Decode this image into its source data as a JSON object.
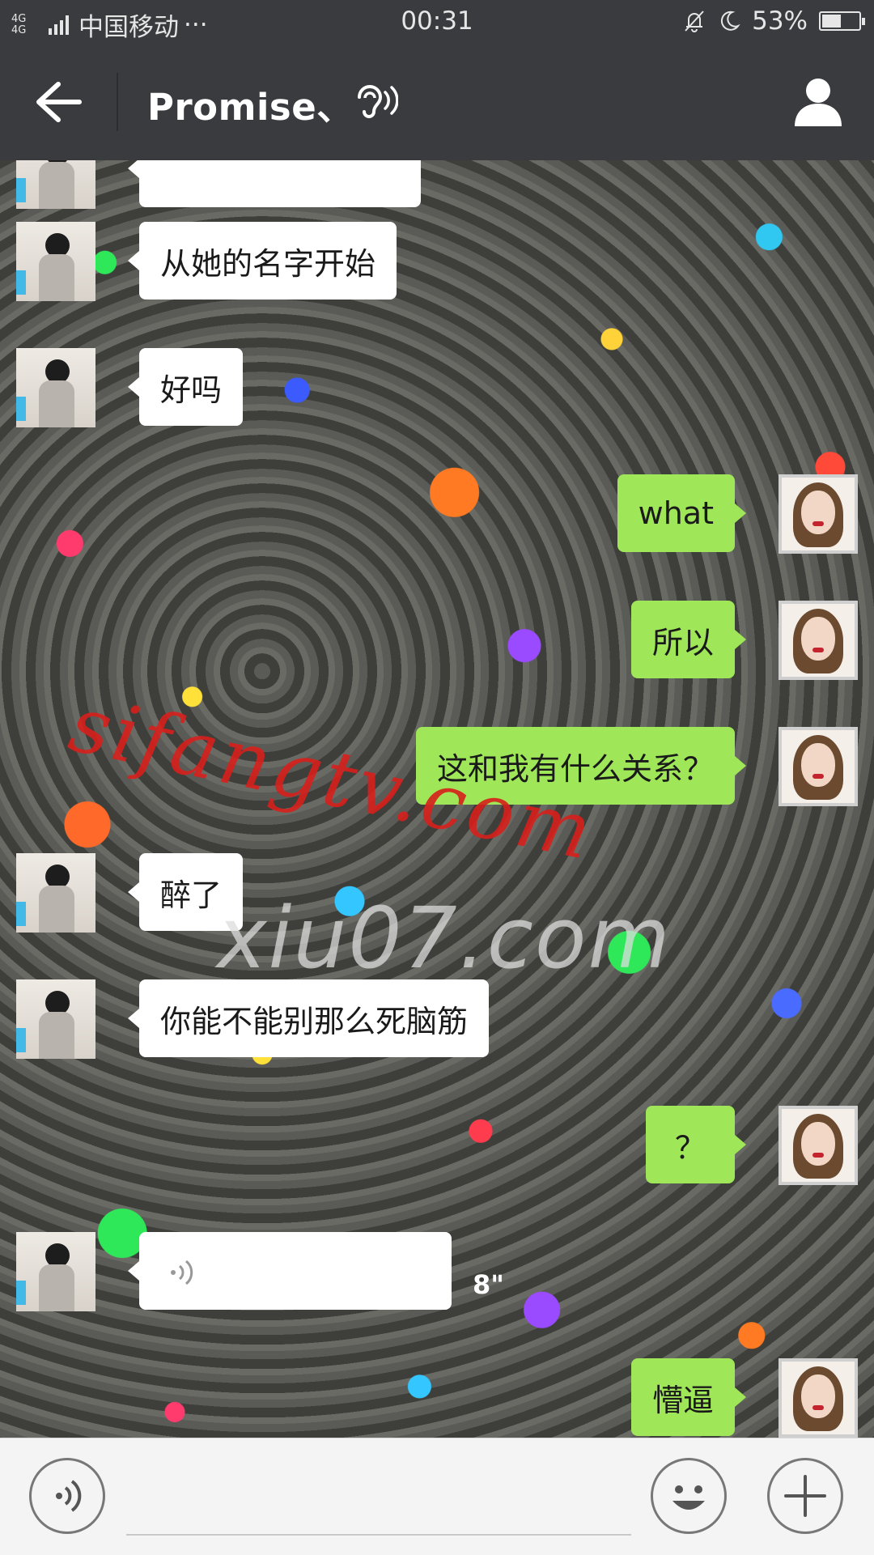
{
  "status_bar": {
    "network": "4G 4G",
    "carrier": "中国移动",
    "more": "···",
    "time": "00:31",
    "battery": "53%",
    "battery_level": 0.53
  },
  "header": {
    "title": "Promise、",
    "icons": {
      "back": "arrow-left-icon",
      "earpiece": "ear-icon",
      "profile": "person-icon"
    }
  },
  "messages": [
    {
      "from": "them",
      "text": "从她的名字开始"
    },
    {
      "from": "them",
      "text": "好吗"
    },
    {
      "from": "me",
      "text": "what"
    },
    {
      "from": "me",
      "text": "所以"
    },
    {
      "from": "me",
      "text": "这和我有什么关系？"
    },
    {
      "from": "them",
      "text": "醉了"
    },
    {
      "from": "them",
      "text": "你能不能别那么死脑筋"
    },
    {
      "from": "me",
      "text": "？"
    },
    {
      "from": "them",
      "type": "voice",
      "duration": "8\""
    },
    {
      "from": "me",
      "text": "懵逼"
    }
  ],
  "watermarks": {
    "red": "sifangtv.com",
    "gray": "xiu07.com"
  },
  "input_bar": {
    "icons": {
      "voice": "voice-icon",
      "emoji": "emoji-icon",
      "more": "plus-icon"
    }
  },
  "colors": {
    "bar": "#3a3b3e",
    "bubble_me": "#9fe658",
    "bubble_them": "#ffffff"
  }
}
